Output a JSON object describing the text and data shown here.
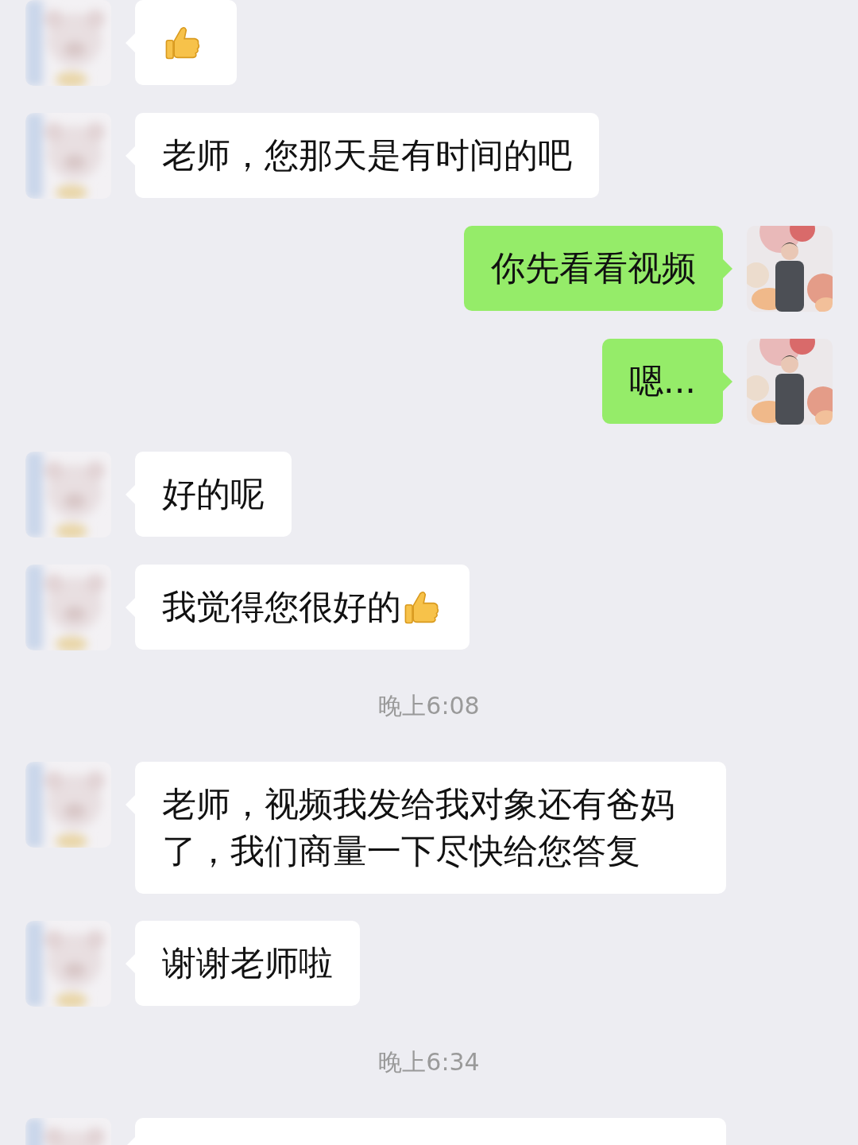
{
  "messages": [
    {
      "kind": "incoming",
      "thumbs_up": true
    },
    {
      "kind": "incoming",
      "text": "老师，您那天是有时间的吧",
      "thumbs_up": false
    },
    {
      "kind": "outgoing",
      "text": "你先看看视频",
      "thumbs_up": false
    },
    {
      "kind": "outgoing",
      "text": "嗯...",
      "thumbs_up": false
    },
    {
      "kind": "incoming",
      "text": "好的呢",
      "thumbs_up": false
    },
    {
      "kind": "incoming",
      "text": "我觉得您很好的",
      "thumbs_up": true
    },
    {
      "kind": "time",
      "text": "晚上6:08"
    },
    {
      "kind": "incoming",
      "text": "老师，视频我发给我对象还有爸妈了，我们商量一下尽快给您答复",
      "thumbs_up": false
    },
    {
      "kind": "incoming",
      "text": "谢谢老师啦",
      "thumbs_up": false
    },
    {
      "kind": "time",
      "text": "晚上6:34"
    },
    {
      "kind": "incoming",
      "thumbs_up": false
    }
  ]
}
